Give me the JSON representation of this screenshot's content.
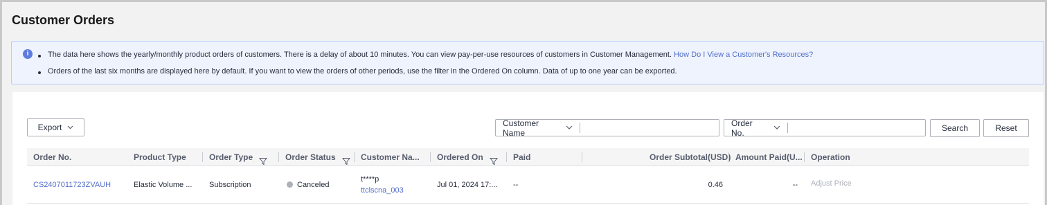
{
  "page": {
    "title": "Customer Orders"
  },
  "notice": {
    "line1": "The data here shows the yearly/monthly product orders of customers. There is a delay of about 10 minutes. You can view pay-per-use resources of customers in Customer Management.",
    "line1_link": "How Do I View a Customer's Resources?",
    "line2": "Orders of the last six months are displayed here by default. If you want to view the orders of other periods, use the filter in the Ordered On column. Data of up to one year can be exported."
  },
  "toolbar": {
    "export_label": "Export",
    "customer_filter_label": "Customer Name",
    "customer_filter_value": "",
    "order_filter_label": "Order No.",
    "order_filter_value": "",
    "search_label": "Search",
    "reset_label": "Reset"
  },
  "table": {
    "columns": {
      "order_no": "Order No.",
      "product_type": "Product Type",
      "order_type": "Order Type",
      "order_status": "Order Status",
      "customer_name": "Customer Na...",
      "ordered_on": "Ordered On",
      "paid": "Paid",
      "order_subtotal": "Order Subtotal(USD)",
      "amount_paid": "Amount Paid(U...",
      "operation": "Operation"
    },
    "rows": [
      {
        "order_no": "CS2407011723ZVAUH",
        "product_type": "Elastic Volume ...",
        "order_type": "Subscription",
        "order_status": "Canceled",
        "customer_masked": "t****p",
        "customer_account": "ttclscna_003",
        "ordered_on": "Jul 01, 2024 17:...",
        "paid": "--",
        "order_subtotal": "0.46",
        "amount_paid": "--",
        "operation": "Adjust Price"
      }
    ]
  },
  "colors": {
    "link": "#526ecc",
    "info": "#5e7ce0",
    "notice_bg": "#eef3fd",
    "status_canceled": "#adb0b8"
  }
}
